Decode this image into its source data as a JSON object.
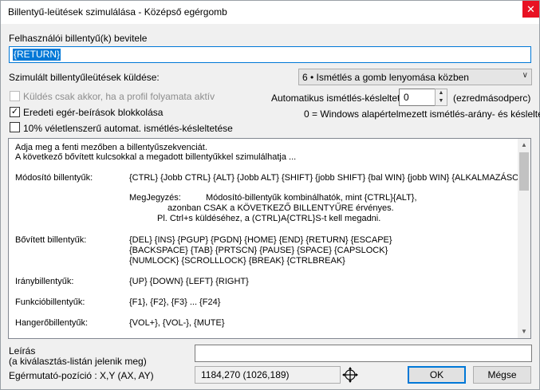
{
  "window": {
    "title": "Billentyű-leütések szimulálása - Középső egérgomb",
    "close_glyph": "✕"
  },
  "input": {
    "label": "Felhasználói billentyű(k) bevitele",
    "value": "{RETURN}"
  },
  "send": {
    "label": "Szimulált billentyűleütések küldése:",
    "selected": "6 • Ismétlés a gomb lenyomása közben"
  },
  "profile_only": {
    "label": "Küldés csak akkor, ha a profil folyamata aktív",
    "checked": false
  },
  "block_mouse": {
    "label": "Eredeti egér-beírások blokkolása",
    "checked": true
  },
  "random_delay": {
    "label": "10% véletlenszerű automat. ismétlés-késleltetése",
    "checked": false
  },
  "auto_repeat": {
    "label": "Automatikus ismétlés-késleltetés",
    "value": "0",
    "unit": "(ezredmásodperc)",
    "hint": "0 = Windows alapértelmezett ismétlés-arány- és késleltetés"
  },
  "help": {
    "intro1": "Adja meg a fenti mezőben a billentyűszekvenciát.",
    "intro2": "A következő bővített kulcsokkal a megadott billentyűkkel szimulálhatja ...",
    "modifiers_label": "Módosító billentyűk:",
    "modifiers_value": "{CTRL} {Jobb CTRL} {ALT} {Jobb ALT} {SHIFT} {jobb SHIFT} {bal WIN} {jobb WIN} {ALKALMAZÁSO",
    "note_label": "MegJegyzés:",
    "note1": "Módosító-billentyűk kombinálhatók, mint {CTRL}{ALT},",
    "note2": "azonban CSAK a KÖVETKEZŐ BILLENTYŰRE érvényes.",
    "note3": "Pl. Ctrl+s küldéséhez, a (CTRL)A{CTRL}S-t kell megadni.",
    "extended_label": "Bővített billentyűk:",
    "extended1": "{DEL} {INS} {PGUP} {PGDN} {HOME} {END} {RETURN} {ESCAPE}",
    "extended2": "{BACKSPACE} {TAB} {PRTSCN} {PAUSE} {SPACE} {CAPSLOCK}",
    "extended3": "{NUMLOCK} {SCROLLLOCK} {BREAK} {CTRLBREAK}",
    "direction_label": "Iránybillentyűk:",
    "direction_value": "{UP} {DOWN} {LEFT} {RIGHT}",
    "function_label": "Funkcióbillentyűk:",
    "function_value": "{F1}, {F2}, {F3} ... {F24}",
    "volume_label": "Hangerőbillentyűk:",
    "volume_value": "{VOL+}, {VOL-}, {MUTE}"
  },
  "description": {
    "label1": "Leírás",
    "label2": "(a kiválasztás-listán jelenik meg)",
    "value": ""
  },
  "cursor": {
    "label": "Egérmutató-pozíció : X,Y (AX, AY)",
    "value": "1184,270 (1026,189)"
  },
  "buttons": {
    "ok": "OK",
    "cancel": "Mégse"
  }
}
